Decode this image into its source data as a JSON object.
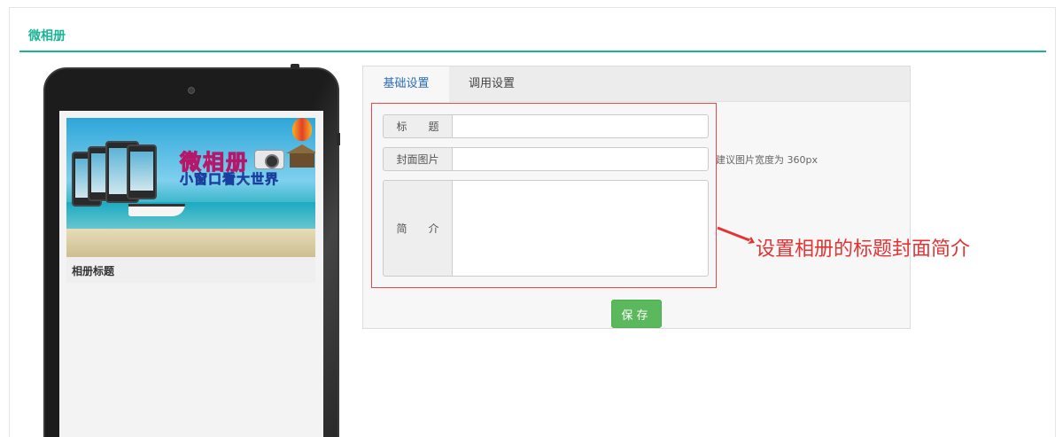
{
  "page": {
    "title": "微相册",
    "accent_color": "#1ab394"
  },
  "preview": {
    "album_title": "相册标题",
    "cover_text": {
      "title": "微相册",
      "subtitle": "小窗口看大世界"
    }
  },
  "tabs": [
    {
      "label": "基础设置",
      "active": true
    },
    {
      "label": "调用设置",
      "active": false
    }
  ],
  "form": {
    "title_label": "标　　题",
    "title_value": "",
    "cover_label": "封面图片",
    "cover_value": "",
    "cover_hint": "建议图片宽度为 360px",
    "intro_label": "简　　介",
    "intro_value": ""
  },
  "save_button": {
    "label": "保存",
    "color": "#5cb85c"
  },
  "annotation": {
    "text": "设置相册的标题封面简介",
    "color": "#e53333"
  }
}
